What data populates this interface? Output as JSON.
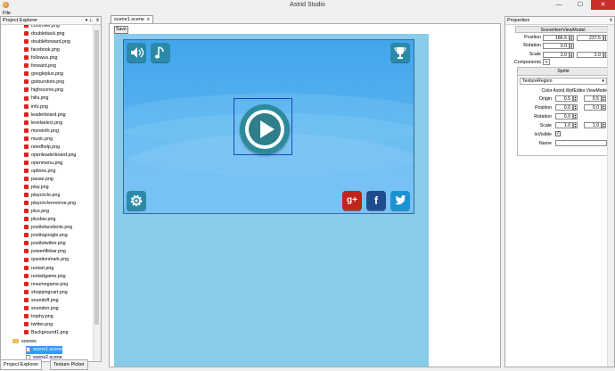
{
  "window": {
    "title": "Astrid Studio",
    "minimize": "—",
    "maximize": "☐",
    "close": "✕"
  },
  "menu": {
    "file": "File"
  },
  "project_explorer": {
    "title": "Project Explorer",
    "pin": "▾ ⊥",
    "close": "x",
    "files": [
      "controller.png",
      "doubleback.png",
      "doubleforward.png",
      "facebook.png",
      "followus.png",
      "forward.png",
      "googleplus.png",
      "gotourstore.png",
      "highscores.png",
      "hills.png",
      "info.png",
      "leaderboard.png",
      "levelselect.png",
      "moreinfo.png",
      "music.png",
      "needhelp.png",
      "openleaderboard.png",
      "openmenu.png",
      "options.png",
      "pause.png",
      "play.png",
      "playcircle.png",
      "playcirclereverse.png",
      "plus.png",
      "plusbar.png",
      "posttofacebook.png",
      "posttogoogle.png",
      "posttotwitter.png",
      "powerlifebar.png",
      "questionmark.png",
      "restart.png",
      "restartgame.png",
      "resumegame.png",
      "shoppingcart.png",
      "soundoff.png",
      "soundon.png",
      "trophy.png",
      "twitter.png",
      "Background1.png"
    ],
    "folder": "scenes",
    "scenes": [
      "scene1.scene",
      "scene2.scene"
    ]
  },
  "bottom_tabs": [
    "Project Explorer",
    "Texture Picker"
  ],
  "scene": {
    "tab": "scene1.scene",
    "tab_close": "x",
    "save": "Save",
    "images": [
      "E:\\Temp\\Astrid\\images\\Background",
      "E:\\Temp\\Astrid\\images\\playcircle.pn",
      "E:\\Temp\\Astrid\\images\\twitter.png",
      "E:\\Temp\\Astrid\\images\\facebook.pn",
      "E:\\Temp\\Astrid\\images\\cog.png",
      "E:\\Temp\\Astrid\\images\\googleplus.p",
      "E:\\Temp\\Astrid\\images\\soundon.pn",
      "E:\\Temp\\Astrid\\images\\music.png",
      "E:\\Temp\\Astrid\\images\\trophy.png"
    ],
    "google_label": "g+",
    "facebook_label": "f"
  },
  "properties": {
    "title": "Properties",
    "close": "x",
    "header": "SceneItemViewModel",
    "position_label": "Position",
    "position_x": "186.5",
    "position_y": "237.5",
    "rotation_label": "Rotation",
    "rotation": "0.0",
    "scale_label": "Scale",
    "scale_x": "2.0",
    "scale_y": "2.0",
    "components_label": "Components",
    "components_add": "+",
    "sprite_title": "Sprite",
    "texture_region": "TextureRegion",
    "color": "Color Astrid.WpfEditor.ViewMode",
    "origin_label": "Origin",
    "origin_x": "0.5",
    "origin_y": "0.5",
    "s_position_label": "Position",
    "s_position_x": "0.0",
    "s_position_y": "0.0",
    "s_rotation_label": "Rotation",
    "s_rotation": "0.0",
    "s_scale_label": "Scale",
    "s_scale_x": "1.0",
    "s_scale_y": "1.0",
    "isvisible_label": "IsVisible",
    "isvisible_check": "✓",
    "name_label": "Name"
  },
  "colors": {
    "accent": "#3399ff",
    "canvas": "#88cce9",
    "game_bg": "#42a5ec",
    "google_red": "#c0241b",
    "facebook_blue": "#1f4c8f",
    "twitter_blue": "#1b93d3",
    "button_teal": "#2a8aa8"
  }
}
